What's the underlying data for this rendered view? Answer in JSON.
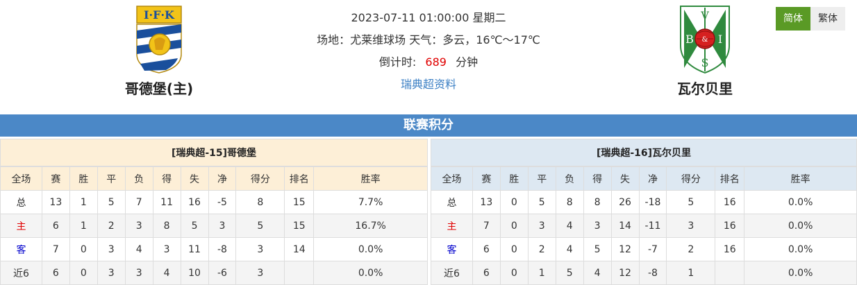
{
  "match": {
    "datetime": "2023-07-11 01:00:00 星期二",
    "venue_line": "场地：尤莱维球场 天气：多云，16℃～17℃",
    "countdown_label": "倒计时:",
    "countdown_value": "689",
    "countdown_unit": "分钟",
    "league_link": "瑞典超资料"
  },
  "home": {
    "name": "哥德堡(主)",
    "logo_text": "I·F·K"
  },
  "away": {
    "name": "瓦尔贝里",
    "logo_letters": [
      "V",
      "B",
      "I",
      "S",
      "&"
    ]
  },
  "lang": {
    "simplified": "简体",
    "traditional": "繁体"
  },
  "section_title": "联赛积分",
  "headers": [
    "全场",
    "赛",
    "胜",
    "平",
    "负",
    "得",
    "失",
    "净",
    "得分",
    "排名",
    "胜率"
  ],
  "home_table": {
    "title": "[瑞典超-15]哥德堡",
    "rows": [
      [
        "总",
        "13",
        "1",
        "5",
        "7",
        "11",
        "16",
        "-5",
        "8",
        "15",
        "7.7%"
      ],
      [
        "主",
        "6",
        "1",
        "2",
        "3",
        "8",
        "5",
        "3",
        "5",
        "15",
        "16.7%"
      ],
      [
        "客",
        "7",
        "0",
        "3",
        "4",
        "3",
        "11",
        "-8",
        "3",
        "14",
        "0.0%"
      ],
      [
        "近6",
        "6",
        "0",
        "3",
        "3",
        "4",
        "10",
        "-6",
        "3",
        "",
        "0.0%"
      ]
    ]
  },
  "away_table": {
    "title": "[瑞典超-16]瓦尔贝里",
    "rows": [
      [
        "总",
        "13",
        "0",
        "5",
        "8",
        "8",
        "26",
        "-18",
        "5",
        "16",
        "0.0%"
      ],
      [
        "主",
        "7",
        "0",
        "3",
        "4",
        "3",
        "14",
        "-11",
        "3",
        "16",
        "0.0%"
      ],
      [
        "客",
        "6",
        "0",
        "2",
        "4",
        "5",
        "12",
        "-7",
        "2",
        "16",
        "0.0%"
      ],
      [
        "近6",
        "6",
        "0",
        "1",
        "5",
        "4",
        "12",
        "-8",
        "1",
        "",
        "0.0%"
      ]
    ]
  },
  "colors": {
    "banner": "#4b88c7",
    "home_header": "#fdefd7",
    "away_header": "#dde8f2",
    "home_row": "#e00000",
    "away_row": "#0000cc",
    "countdown": "#e00000",
    "lang_active": "#5a9a25"
  }
}
